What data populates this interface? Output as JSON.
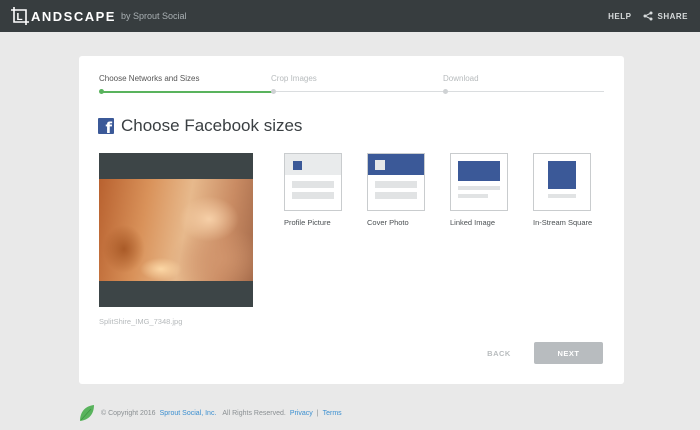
{
  "topbar": {
    "logo_text": "ANDSCAPE",
    "logo_letter": "L",
    "by_text": "by Sprout Social",
    "help_label": "HELP",
    "share_label": "SHARE"
  },
  "steps": [
    {
      "label": "Choose Networks and Sizes",
      "state": "done"
    },
    {
      "label": "Crop Images",
      "state": "pending"
    },
    {
      "label": "Download",
      "state": "pending"
    }
  ],
  "main": {
    "title": "Choose Facebook sizes",
    "network_icon": "facebook-icon",
    "filename": "SplitShire_IMG_7348.jpg"
  },
  "options": [
    {
      "label": "Profile Picture"
    },
    {
      "label": "Cover Photo"
    },
    {
      "label": "Linked Image"
    },
    {
      "label": "In-Stream Square"
    }
  ],
  "actions": {
    "back_label": "BACK",
    "next_label": "NEXT"
  },
  "footer": {
    "copyright": "© Copyright 2016",
    "company_link": "Sprout Social, Inc.",
    "rights": "All Rights Reserved.",
    "privacy_link": "Privacy",
    "separator": "|",
    "terms_link": "Terms"
  },
  "colors": {
    "topbar": "#373d3f",
    "accent_green": "#59b35d",
    "facebook_blue": "#3b5998",
    "link_blue": "#3b8fd0"
  }
}
